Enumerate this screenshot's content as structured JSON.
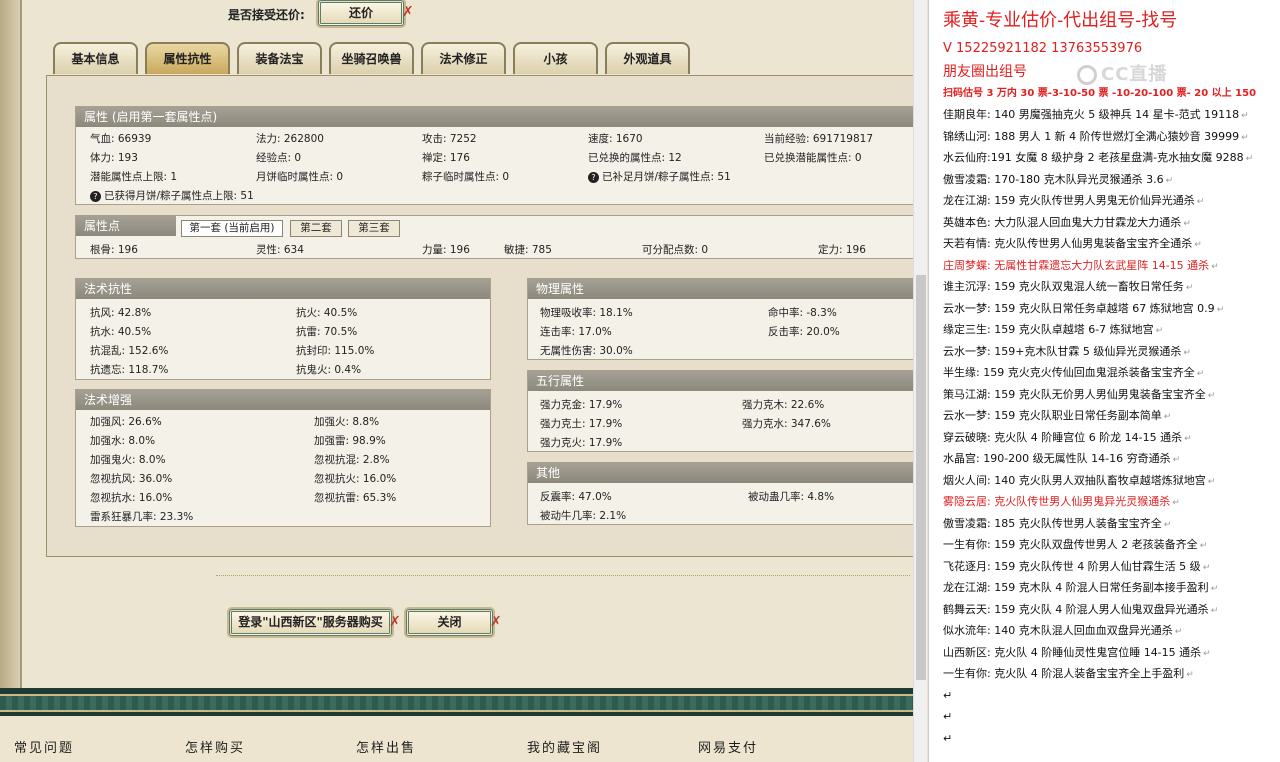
{
  "offer": {
    "label": "是否接受还价:",
    "button": "还价"
  },
  "tabs": [
    "基本信息",
    "属性抗性",
    "装备法宝",
    "坐骑召唤兽",
    "法术修正",
    "小孩",
    "外观道具"
  ],
  "attr_panel": {
    "header": "属性 (启用第一套属性点)",
    "rows": [
      [
        "气血: 66939",
        "法力: 262800",
        "攻击: 7252",
        "速度: 1670",
        "当前经验: 691719817"
      ],
      [
        "体力: 193",
        "经验点: 0",
        "禅定: 176",
        "已兑换的属性点: 12",
        "已兑换潜能属性点: 0"
      ],
      [
        "潜能属性点上限: 1",
        "月饼临时属性点: 0",
        "粽子临时属性点: 0",
        "已补足月饼/粽子属性点: 51"
      ]
    ],
    "note": "已获得月饼/粽子属性点上限: 51"
  },
  "points_panel": {
    "header": "属性点",
    "subtabs": [
      "第一套 (当前启用)",
      "第二套",
      "第三套"
    ],
    "row": [
      "根骨: 196",
      "灵性: 634",
      "力量: 196",
      "敏捷: 785",
      "可分配点数: 0",
      "定力: 196"
    ]
  },
  "resist_panel": {
    "header": "法术抗性",
    "left": [
      "抗风: 42.8%",
      "抗水: 40.5%",
      "抗混乱: 152.6%",
      "抗遗忘: 118.7%"
    ],
    "right": [
      "抗火: 40.5%",
      "抗雷: 70.5%",
      "抗封印: 115.0%",
      "抗鬼火: 0.4%"
    ]
  },
  "enhance_panel": {
    "header": "法术增强",
    "left": [
      "加强风: 26.6%",
      "加强水: 8.0%",
      "加强鬼火: 8.0%",
      "忽视抗风: 36.0%",
      "忽视抗水: 16.0%",
      "雷系狂暴几率: 23.3%"
    ],
    "right": [
      "加强火: 8.8%",
      "加强雷: 98.9%",
      "忽视抗混: 2.8%",
      "忽视抗火: 16.0%",
      "忽视抗雷: 65.3%"
    ]
  },
  "phys_panel": {
    "header": "物理属性",
    "left": [
      "物理吸收率: 18.1%",
      "连击率: 17.0%",
      "无属性伤害: 30.0%"
    ],
    "right": [
      "命中率: -8.3%",
      "反击率: 20.0%"
    ]
  },
  "five_panel": {
    "header": "五行属性",
    "left": [
      "强力克金: 17.9%",
      "强力克土: 17.9%",
      "强力克火: 17.9%"
    ],
    "right": [
      "强力克木: 22.6%",
      "强力克水: 347.6%"
    ]
  },
  "other_panel": {
    "header": "其他",
    "left": [
      "反震率: 47.0%",
      "被动牛几率: 2.1%"
    ],
    "right": [
      "被动蛊几率: 4.8%"
    ]
  },
  "bottom_buttons": {
    "buy": "登录\"山西新区\"服务器购买",
    "close": "关闭"
  },
  "footer_links": [
    "常见问题",
    "怎样购买",
    "怎样出售",
    "我的藏宝阁",
    "网易支付"
  ],
  "doc": {
    "title": "乘黄-专业估价-代出组号-找号",
    "phone": "V 15225921182   13763553976",
    "moments": "朋友圈出组号",
    "scan": "扫码估号 3 万内 30 票-3-10-50 票  -10-20-100 票- 20 以上 150",
    "watermark": "CC直播",
    "lines": [
      {
        "text": "佳期良年: 140 男魔强抽克火 5 级神兵 14 星卡-范式 19118",
        "red": false
      },
      {
        "text": "锦绣山河: 188 男人 1 新 4 阶传世燃灯全满心猿妙音 39999",
        "red": false
      },
      {
        "text": "水云仙府:191 女魔 8 级护身 2 老孩星盘满-克水抽女魔 9288",
        "red": false
      },
      {
        "text": "傲雪凌霜: 170-180 克木队异光灵猴通杀 3.6",
        "red": false
      },
      {
        "text": "龙在江湖: 159 克火队传世男人男鬼无价仙异光通杀",
        "red": false
      },
      {
        "text": "英雄本色: 大力队混人回血鬼大力甘霖龙大力通杀",
        "red": false
      },
      {
        "text": "天若有情: 克火队传世男人仙男鬼装备宝宝齐全通杀",
        "red": false
      },
      {
        "text": "庄周梦蝶: 无属性甘霖遗忘大力队玄武星阵 14-15 通杀",
        "red": true
      },
      {
        "text": "谁主沉浮: 159 克火队双鬼混人统一畜牧日常任务",
        "red": false
      },
      {
        "text": "云水一梦: 159 克火队日常任务卓越塔 67 炼狱地宫 0.9",
        "red": false
      },
      {
        "text": "缘定三生: 159 克火队卓越塔 6-7 炼狱地宫",
        "red": false
      },
      {
        "text": "云水一梦: 159+克木队甘霖 5 级仙异光灵猴通杀",
        "red": false
      },
      {
        "text": "半生缘: 159 克火克火传仙回血鬼混杀装备宝宝齐全",
        "red": false
      },
      {
        "text": "策马江湖: 159 克火队无价男人男仙男鬼装备宝宝齐全",
        "red": false
      },
      {
        "text": "云水一梦: 159 克火队职业日常任务副本简单",
        "red": false
      },
      {
        "text": "穿云破晓: 克火队 4 阶睡宫位 6 阶龙 14-15 通杀",
        "red": false
      },
      {
        "text": "水晶宫: 190-200 级无属性队 14-16 穷奇通杀",
        "red": false
      },
      {
        "text": "烟火人间: 140 克火队男人双抽队畜牧卓越塔炼狱地宫",
        "red": false
      },
      {
        "text": "雾隐云居: 克火队传世男人仙男鬼异光灵猴通杀",
        "red": true
      },
      {
        "text": "傲雪凌霜: 185 克火队传世男人装备宝宝齐全",
        "red": false
      },
      {
        "text": "一生有你: 159 克火队双盘传世男人 2 老孩装备齐全",
        "red": false
      },
      {
        "text": "飞花逐月: 159 克火队传世 4 阶男人仙甘霖生活 5 级",
        "red": false
      },
      {
        "text": "龙在江湖: 159 克木队 4 阶混人日常任务副本接手盈利",
        "red": false
      },
      {
        "text": "鹤舞云天: 159 克火队 4 阶混人男人仙鬼双盘异光通杀",
        "red": false
      },
      {
        "text": "似水流年: 140 克木队混人回血血双盘异光通杀",
        "red": false
      },
      {
        "text": "山西新区: 克火队 4 阶睡仙灵性鬼宫位睡 14-15 通杀",
        "red": false
      },
      {
        "text": "一生有你: 克火队 4 阶混人装备宝宝齐全上手盈利",
        "red": false
      }
    ]
  }
}
